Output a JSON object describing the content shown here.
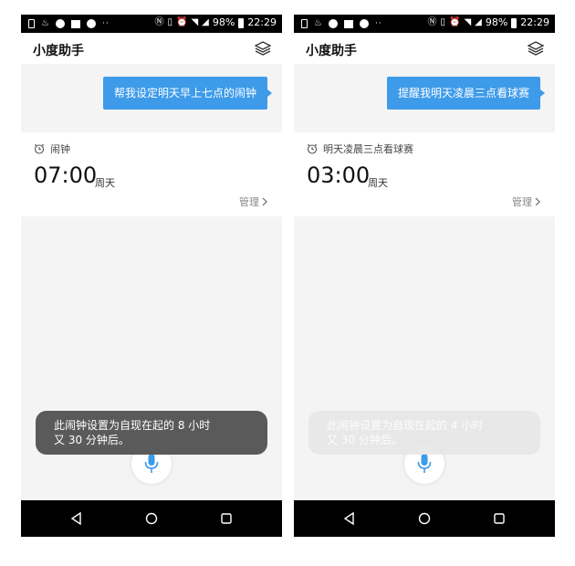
{
  "status_bar": {
    "battery": "98%",
    "time": "22:29",
    "ellipsis": "··"
  },
  "app": {
    "title": "小度助手"
  },
  "screens": [
    {
      "query": "帮我设定明天早上七点的闹钟",
      "card_label": "闹钟",
      "alarm_time": "07:00",
      "alarm_day": "周天",
      "manage_label": "管理",
      "toast_line1": "此闹钟设置为自现在起的 8 小时",
      "toast_line2": "又 30 分钟后。"
    },
    {
      "query": "提醒我明天凌晨三点看球赛",
      "card_label": "明天凌晨三点看球赛",
      "alarm_time": "03:00",
      "alarm_day": "周天",
      "manage_label": "管理",
      "toast_line1": "此闹钟设置为自现在起的 4 小时",
      "toast_line2": "又 30 分钟后。"
    }
  ],
  "colors": {
    "accent": "#3d9be9",
    "toast": "#5a5a5a",
    "background": "#f4f4f4"
  }
}
